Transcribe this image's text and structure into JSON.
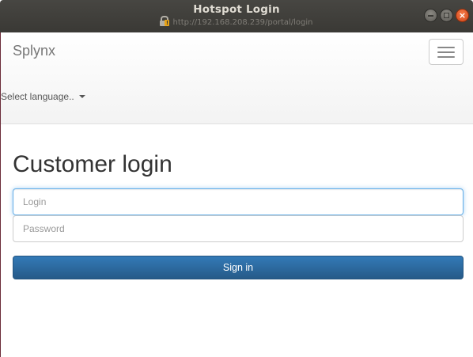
{
  "window": {
    "title": "Hotspot Login",
    "url": "http://192.168.208.239/portal/login",
    "controls": {
      "minimize": "minimize",
      "maximize": "maximize",
      "close": "×"
    }
  },
  "navbar": {
    "brand": "Splynx",
    "language_selector": "Select language.."
  },
  "login": {
    "heading": "Customer login",
    "login_placeholder": "Login",
    "password_placeholder": "Password",
    "submit_label": "Sign in"
  },
  "colors": {
    "primary_button": "#337ab7",
    "focus_ring": "#66afe9",
    "titlebar": "#3c3b37",
    "close_button": "#e95420"
  }
}
